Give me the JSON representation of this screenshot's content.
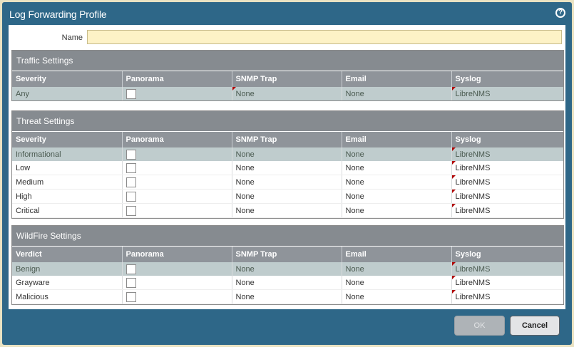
{
  "dialog": {
    "title": "Log Forwarding Profile",
    "help_glyph": "?"
  },
  "name_field": {
    "label": "Name",
    "value": ""
  },
  "sections": {
    "traffic": {
      "title": "Traffic Settings",
      "columns": [
        "Severity",
        "Panorama",
        "SNMP Trap",
        "Email",
        "Syslog"
      ],
      "rows": [
        {
          "label": "Any",
          "snmp": "None",
          "email": "None",
          "syslog": "LibreNMS"
        }
      ]
    },
    "threat": {
      "title": "Threat Settings",
      "columns": [
        "Severity",
        "Panorama",
        "SNMP Trap",
        "Email",
        "Syslog"
      ],
      "rows": [
        {
          "label": "Informational",
          "snmp": "None",
          "email": "None",
          "syslog": "LibreNMS"
        },
        {
          "label": "Low",
          "snmp": "None",
          "email": "None",
          "syslog": "LibreNMS"
        },
        {
          "label": "Medium",
          "snmp": "None",
          "email": "None",
          "syslog": "LibreNMS"
        },
        {
          "label": "High",
          "snmp": "None",
          "email": "None",
          "syslog": "LibreNMS"
        },
        {
          "label": "Critical",
          "snmp": "None",
          "email": "None",
          "syslog": "LibreNMS"
        }
      ]
    },
    "wildfire": {
      "title": "WildFire Settings",
      "columns": [
        "Verdict",
        "Panorama",
        "SNMP Trap",
        "Email",
        "Syslog"
      ],
      "rows": [
        {
          "label": "Benign",
          "snmp": "None",
          "email": "None",
          "syslog": "LibreNMS"
        },
        {
          "label": "Grayware",
          "snmp": "None",
          "email": "None",
          "syslog": "LibreNMS"
        },
        {
          "label": "Malicious",
          "snmp": "None",
          "email": "None",
          "syslog": "LibreNMS"
        }
      ]
    }
  },
  "buttons": {
    "ok": "OK",
    "cancel": "Cancel"
  },
  "colors": {
    "titlebar": "#2e6788",
    "section_header": "#868b90",
    "selected_row": "#bfcccd",
    "name_input_bg": "#fdf2c6"
  }
}
